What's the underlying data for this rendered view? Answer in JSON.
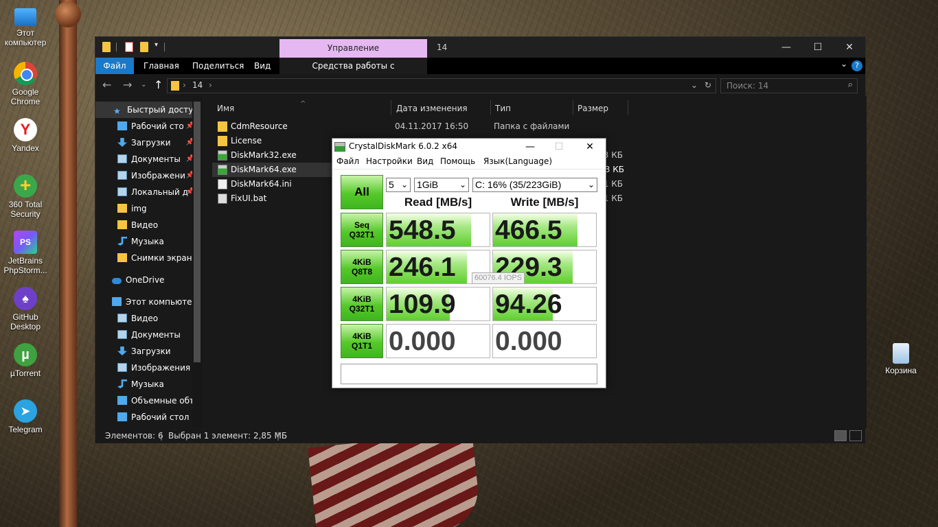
{
  "desktop": {
    "icons": [
      {
        "label": "Этот компьютер",
        "icon": "this-pc-icon"
      },
      {
        "label": "Google Chrome",
        "icon": "chrome-icon"
      },
      {
        "label": "Yandex",
        "icon": "yandex-browser-icon",
        "glyph": "Y"
      },
      {
        "label": "360 Total Security",
        "icon": "360-security-icon",
        "glyph": "+"
      },
      {
        "label": "JetBrains PhpStorm...",
        "icon": "phpstorm-icon",
        "glyph": "PS"
      },
      {
        "label": "GitHub Desktop",
        "icon": "github-desktop-icon",
        "glyph": "♠"
      },
      {
        "label": "µTorrent",
        "icon": "utorrent-icon",
        "glyph": "µ"
      },
      {
        "label": "Telegram",
        "icon": "telegram-icon",
        "glyph": "➤"
      }
    ],
    "recycle_bin": {
      "label": "Корзина",
      "icon": "recycle-bin-icon"
    }
  },
  "explorer": {
    "manage_tab": "Управление",
    "title": "14",
    "window_controls": {
      "minimize": "—",
      "maximize": "☐",
      "close": "✕"
    },
    "ribbon": {
      "file": "Файл",
      "home": "Главная",
      "share": "Поделиться",
      "view": "Вид",
      "app_tools": "Средства работы с приложениями",
      "help": "?"
    },
    "address": {
      "path": "14",
      "sep": "›"
    },
    "search": {
      "placeholder": "Поиск: 14"
    },
    "nav_pane": {
      "quick_access": "Быстрый доступ",
      "items": [
        {
          "label": "Рабочий сто",
          "icon": "desktop-folder-icon",
          "pinned": true
        },
        {
          "label": "Загрузки",
          "icon": "downloads-icon",
          "pinned": true
        },
        {
          "label": "Документы",
          "icon": "documents-icon",
          "pinned": true
        },
        {
          "label": "Изображени",
          "icon": "pictures-icon",
          "pinned": true
        },
        {
          "label": "Локальный д",
          "icon": "local-disk-icon",
          "pinned": true
        },
        {
          "label": "img",
          "icon": "folder-icon",
          "pinned": false
        },
        {
          "label": "Видео",
          "icon": "folder-icon",
          "pinned": false
        },
        {
          "label": "Музыка",
          "icon": "music-icon",
          "pinned": false
        },
        {
          "label": "Снимки экрана",
          "icon": "folder-icon",
          "pinned": false
        }
      ],
      "onedrive": "OneDrive",
      "this_pc": "Этот компьютер",
      "pc_items": [
        {
          "label": "Видео",
          "icon": "videos-icon"
        },
        {
          "label": "Документы",
          "icon": "documents-icon"
        },
        {
          "label": "Загрузки",
          "icon": "downloads-icon"
        },
        {
          "label": "Изображения",
          "icon": "pictures-icon"
        },
        {
          "label": "Музыка",
          "icon": "music-icon"
        },
        {
          "label": "Объемные объ",
          "icon": "3d-objects-icon"
        },
        {
          "label": "Рабочий стол",
          "icon": "desktop-folder-icon"
        }
      ]
    },
    "columns": {
      "name": "Имя",
      "date": "Дата изменения",
      "type": "Тип",
      "size": "Размер"
    },
    "files": [
      {
        "name": "CdmResource",
        "date": "04.11.2017 16:50",
        "type": "Папка с файлами",
        "size": "",
        "icon": "folder-icon"
      },
      {
        "name": "License",
        "date": "",
        "type": "",
        "size": "",
        "icon": "folder-icon"
      },
      {
        "name": "DiskMark32.exe",
        "date": "",
        "type": "",
        "size": "3 КБ",
        "icon": "exe-icon"
      },
      {
        "name": "DiskMark64.exe",
        "date": "",
        "type": "",
        "size": "3 КБ",
        "icon": "exe-icon"
      },
      {
        "name": "DiskMark64.ini",
        "date": "",
        "type": "",
        "size": "1 КБ",
        "icon": "ini-file-icon"
      },
      {
        "name": "FixUI.bat",
        "date": "",
        "type": "",
        "size": "1 КБ",
        "icon": "bat-file-icon"
      }
    ],
    "status": {
      "count": "Элементов: 6",
      "selection": "Выбран 1 элемент: 2,85 МБ"
    }
  },
  "cdm": {
    "title": "CrystalDiskMark 6.0.2 x64",
    "menu": [
      "Файл",
      "Настройки",
      "Вид",
      "Помощь",
      "Язык(Language)"
    ],
    "all_button": "All",
    "count_select": "5",
    "size_select": "1GiB",
    "drive_select": "C: 16% (35/223GiB)",
    "read_header": "Read [MB/s]",
    "write_header": "Write [MB/s]",
    "tests": [
      {
        "line1": "Seq",
        "line2": "Q32T1",
        "read": "548.5",
        "write": "466.5",
        "read_fill": 0.82,
        "write_fill": 0.82
      },
      {
        "line1": "4KiB",
        "line2": "Q8T8",
        "read": "246.1",
        "write": "229.3",
        "read_fill": 0.78,
        "write_fill": 0.77
      },
      {
        "line1": "4KiB",
        "line2": "Q32T1",
        "read": "109.9",
        "write": "94.26",
        "read_fill": 0.61,
        "write_fill": 0.58
      },
      {
        "line1": "4KiB",
        "line2": "Q1T1",
        "read": "0.000",
        "write": "0.000",
        "read_fill": 0,
        "write_fill": 0
      }
    ],
    "tooltip": "60076.4 IOPS",
    "comment": ""
  }
}
